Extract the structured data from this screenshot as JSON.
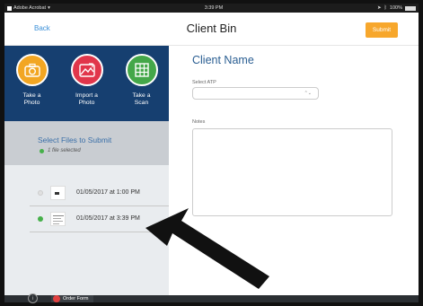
{
  "status": {
    "carrier": "Adobe Acrobat",
    "time": "3:39 PM",
    "battery": "100%"
  },
  "nav": {
    "back": "Back",
    "title": "Client Bin",
    "submit": "Submit"
  },
  "actions": [
    {
      "label": "Take a Photo",
      "icon": "camera-icon",
      "color": "#f2a623"
    },
    {
      "label": "Import a Photo",
      "icon": "photo-icon",
      "color": "#e1364b"
    },
    {
      "label": "Take a Scan",
      "icon": "grid-icon",
      "color": "#44a749"
    }
  ],
  "select_files": {
    "title": "Select Files to Submit",
    "subtitle": "1 file selected"
  },
  "files": [
    {
      "date": "01/05/2017 at 1:00 PM",
      "selected": false
    },
    {
      "date": "01/05/2017 at 3:39 PM",
      "selected": true
    }
  ],
  "form": {
    "client_name": "Client Name",
    "atp_label": "Select ATP",
    "atp_value": "",
    "notes_label": "Notes",
    "notes_value": ""
  },
  "bottom": {
    "info": "i",
    "order_form": "Order Form"
  }
}
